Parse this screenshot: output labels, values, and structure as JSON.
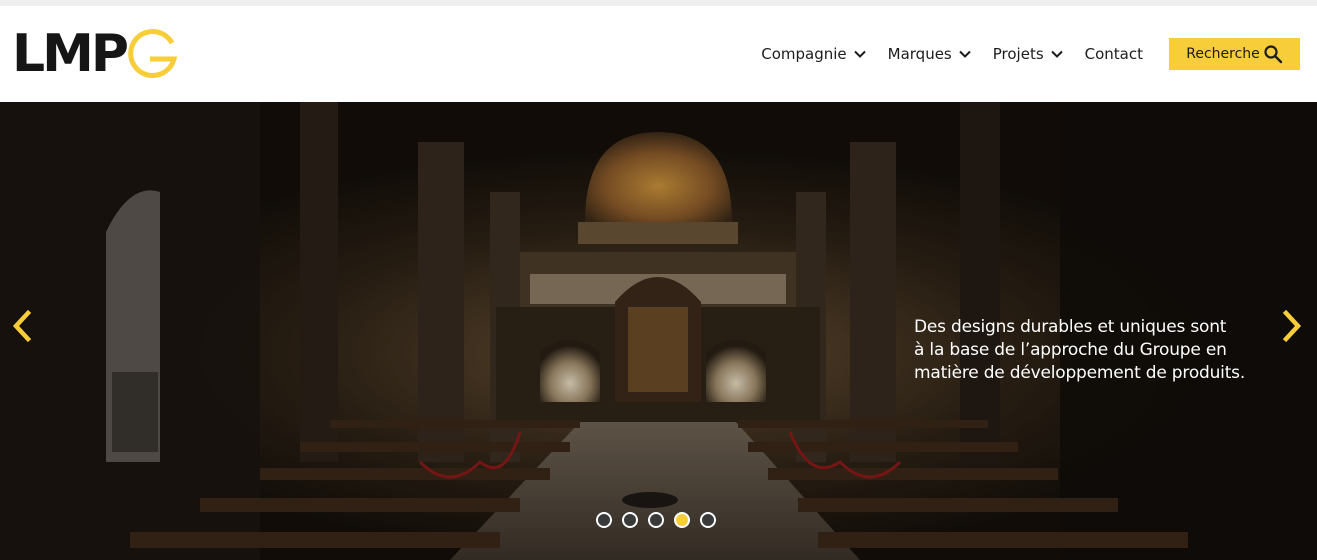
{
  "brand": {
    "logo_text": "LMPG",
    "accent_color": "#f8cd3a"
  },
  "nav": {
    "items": [
      {
        "label": "Compagnie",
        "has_dropdown": true
      },
      {
        "label": "Marques",
        "has_dropdown": true
      },
      {
        "label": "Projets",
        "has_dropdown": true
      },
      {
        "label": "Contact",
        "has_dropdown": false
      }
    ],
    "search_label": "Recherche",
    "search_icon": "search-icon"
  },
  "hero": {
    "caption_lines": [
      "Des designs durables et uniques sont",
      "à la base de l’approche du Groupe en",
      "matière de développement de produits."
    ],
    "prev_icon": "chevron-left-icon",
    "next_icon": "chevron-right-icon",
    "slide_count": 5,
    "active_slide": 4
  }
}
